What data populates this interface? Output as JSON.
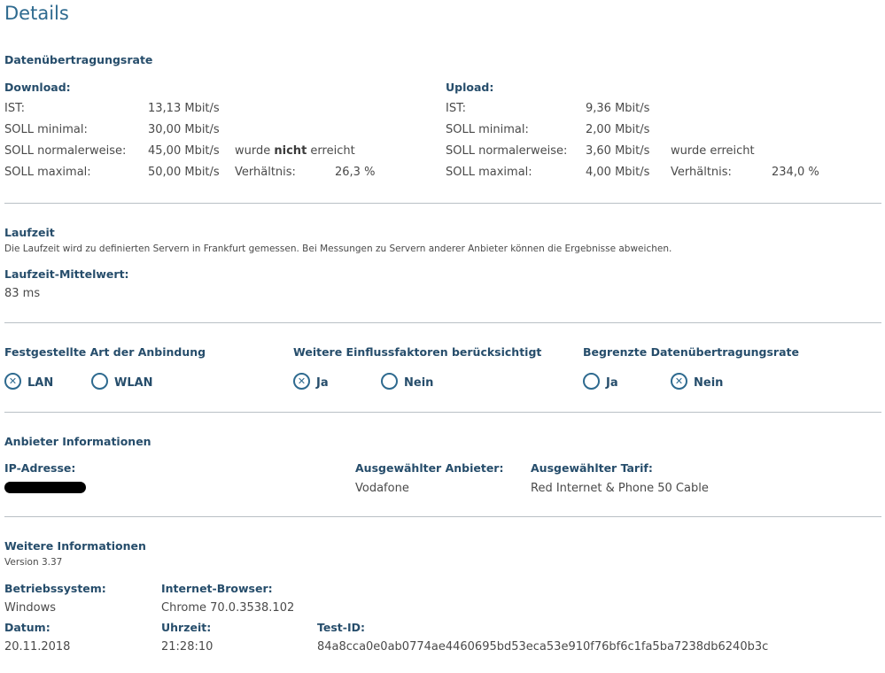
{
  "page_title": "Details",
  "rate": {
    "heading": "Datenübertragungsrate",
    "download": {
      "title": "Download:",
      "ist_label": "IST:",
      "ist_value": "13,13 Mbit/s",
      "min_label": "SOLL minimal:",
      "min_value": "30,00 Mbit/s",
      "normal_label": "SOLL normalerweise:",
      "normal_value": "45,00 Mbit/s",
      "max_label": "SOLL maximal:",
      "max_value": "50,00 Mbit/s",
      "status_pre": "wurde",
      "status_bold": "nicht",
      "status_post": "erreicht",
      "ratio_label": "Verhältnis:",
      "ratio_value": "26,3 %"
    },
    "upload": {
      "title": "Upload:",
      "ist_label": "IST:",
      "ist_value": "9,36 Mbit/s",
      "min_label": "SOLL minimal:",
      "min_value": "2,00 Mbit/s",
      "normal_label": "SOLL normalerweise:",
      "normal_value": "3,60 Mbit/s",
      "max_label": "SOLL maximal:",
      "max_value": "4,00 Mbit/s",
      "status": "wurde erreicht",
      "ratio_label": "Verhältnis:",
      "ratio_value": "234,0 %"
    }
  },
  "latency": {
    "heading": "Laufzeit",
    "description": "Die Laufzeit wird zu definierten Servern in Frankfurt gemessen. Bei Messungen zu Servern anderer Anbieter können die Ergebnisse abweichen.",
    "mean_label": "Laufzeit-Mittelwert:",
    "mean_value": "83 ms"
  },
  "options": {
    "connection": {
      "heading": "Festgestellte Art der Anbindung",
      "opt1": "LAN",
      "opt2": "WLAN",
      "selected": "LAN"
    },
    "factors": {
      "heading": "Weitere Einflussfaktoren berücksichtigt",
      "opt1": "Ja",
      "opt2": "Nein",
      "selected": "Ja"
    },
    "limited": {
      "heading": "Begrenzte Datenübertragungsrate",
      "opt1": "Ja",
      "opt2": "Nein",
      "selected": "Nein"
    },
    "checked_mark": "✕"
  },
  "provider": {
    "heading": "Anbieter Informationen",
    "ip_label": "IP-Adresse:",
    "provider_label": "Ausgewählter Anbieter:",
    "provider_value": "Vodafone",
    "tariff_label": "Ausgewählter Tarif:",
    "tariff_value": "Red Internet & Phone 50 Cable"
  },
  "more": {
    "heading": "Weitere Informationen",
    "version": "Version 3.37",
    "os_label": "Betriebssystem:",
    "os_value": "Windows",
    "browser_label": "Internet-Browser:",
    "browser_value": "Chrome 70.0.3538.102",
    "date_label": "Datum:",
    "date_value": "20.11.2018",
    "time_label": "Uhrzeit:",
    "time_value": "21:28:10",
    "testid_label": "Test-ID:",
    "testid_value": "84a8cca0e0ab0774ae4460695bd53eca53e910f76bf6c1fa5ba7238db6240b3c"
  }
}
